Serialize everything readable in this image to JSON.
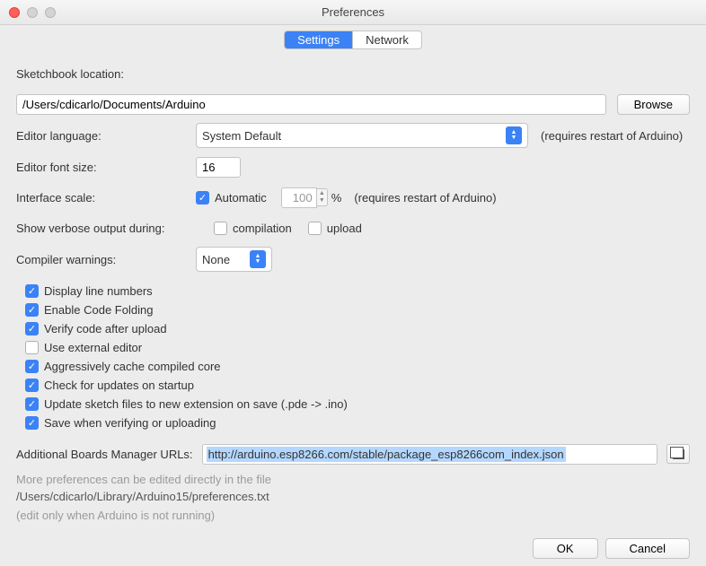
{
  "window": {
    "title": "Preferences"
  },
  "tabs": {
    "settings": "Settings",
    "network": "Network"
  },
  "labels": {
    "sketchbook": "Sketchbook location:",
    "editor_lang": "Editor language:",
    "font_size": "Editor font size:",
    "interface_scale": "Interface scale:",
    "verbose": "Show verbose output during:",
    "compiler_warnings": "Compiler warnings:",
    "boards_urls": "Additional Boards Manager URLs:"
  },
  "values": {
    "sketchbook_path": "/Users/cdicarlo/Documents/Arduino",
    "language": "System Default",
    "font_size": "16",
    "scale_percent": "100",
    "compiler_warning": "None",
    "boards_url": "http://arduino.esp8266.com/stable/package_esp8266com_index.json"
  },
  "hints": {
    "restart": "(requires restart of Arduino)",
    "percent": "%"
  },
  "buttons": {
    "browse": "Browse",
    "ok": "OK",
    "cancel": "Cancel"
  },
  "checkboxes": {
    "automatic": "Automatic",
    "compilation": "compilation",
    "upload": "upload",
    "line_numbers": "Display line numbers",
    "code_folding": "Enable Code Folding",
    "verify_upload": "Verify code after upload",
    "external_editor": "Use external editor",
    "cache_core": "Aggressively cache compiled core",
    "check_updates": "Check for updates on startup",
    "update_ext": "Update sketch files to new extension on save (.pde -> .ino)",
    "save_verify": "Save when verifying or uploading"
  },
  "notes": {
    "more_prefs": "More preferences can be edited directly in the file",
    "prefs_path": "/Users/cdicarlo/Library/Arduino15/preferences.txt",
    "edit_only": "(edit only when Arduino is not running)"
  }
}
